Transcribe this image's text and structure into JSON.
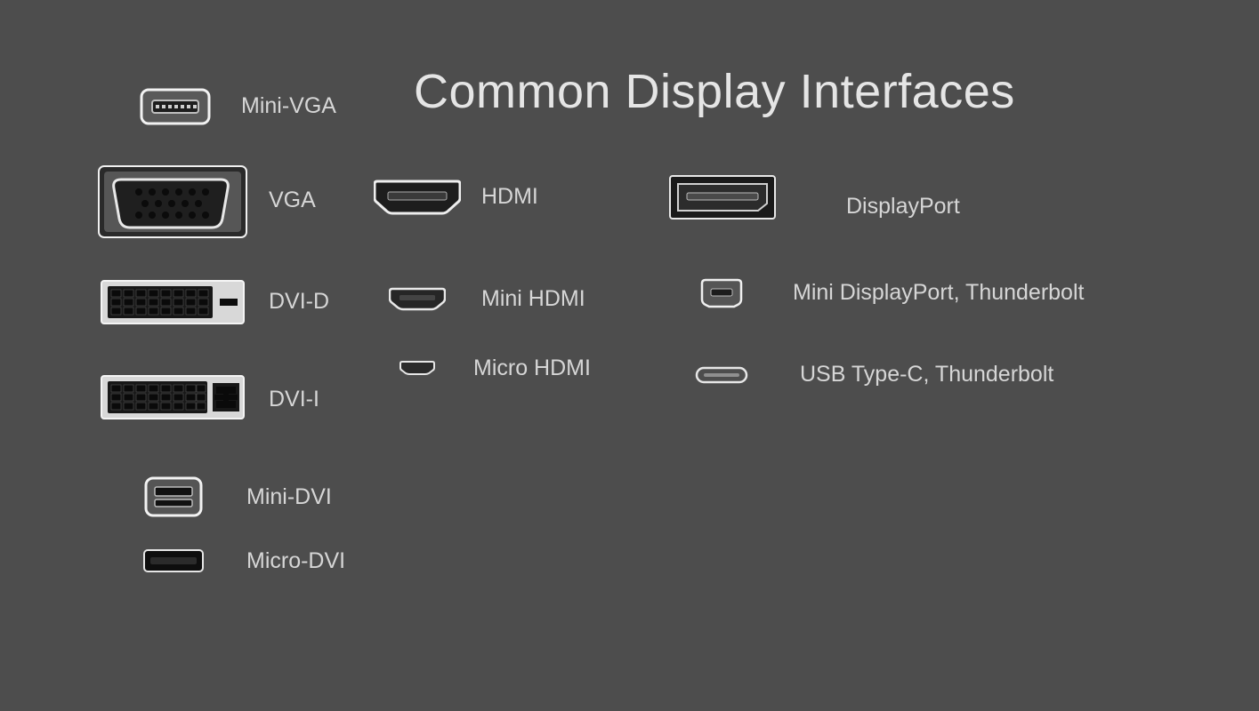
{
  "title": "Common Display Interfaces",
  "connectors": {
    "mini_vga": {
      "label": "Mini-VGA"
    },
    "vga": {
      "label": "VGA"
    },
    "dvi_d": {
      "label": "DVI-D"
    },
    "dvi_i": {
      "label": "DVI-I"
    },
    "mini_dvi": {
      "label": "Mini-DVI"
    },
    "micro_dvi": {
      "label": "Micro-DVI"
    },
    "hdmi": {
      "label": "HDMI"
    },
    "mini_hdmi": {
      "label": "Mini HDMI"
    },
    "micro_hdmi": {
      "label": "Micro HDMI"
    },
    "displayport": {
      "label": "DisplayPort"
    },
    "mini_displayport": {
      "label": "Mini DisplayPort, Thunderbolt"
    },
    "usb_c": {
      "label": "USB Type-C, Thunderbolt"
    }
  }
}
